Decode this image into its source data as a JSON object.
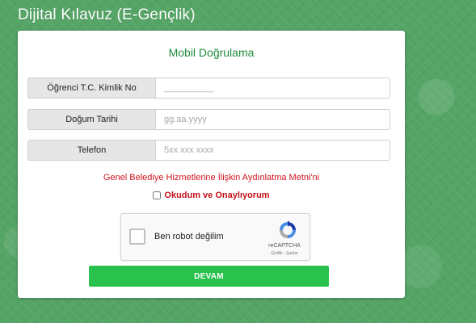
{
  "app": {
    "title": "Dijital Kılavuz (E-Gençlik)"
  },
  "form": {
    "title": "Mobil Doğrulama",
    "fields": [
      {
        "label": "Öğrenci T.C. Kimlik No",
        "placeholder": "__________",
        "value": ""
      },
      {
        "label": "Doğum Tarihi",
        "placeholder": "gg.aa.yyyy",
        "value": ""
      },
      {
        "label": "Telefon",
        "placeholder": "5xx xxx xxxx",
        "value": ""
      }
    ],
    "disclosure_link": "Genel Belediye Hizmetlerine İlişkin Aydınlatma Metni'ni",
    "consent_label": "Okudum ve Onaylıyorum",
    "captcha": {
      "label": "Ben robot değilim",
      "brand": "reCAPTCHA",
      "terms": "Gizlilik - Şartlar"
    },
    "submit_label": "DEVAM"
  },
  "colors": {
    "background": "#55a566",
    "title_green": "#1e8c3a",
    "link_red": "#d0121b",
    "button_green": "#28c24d"
  }
}
